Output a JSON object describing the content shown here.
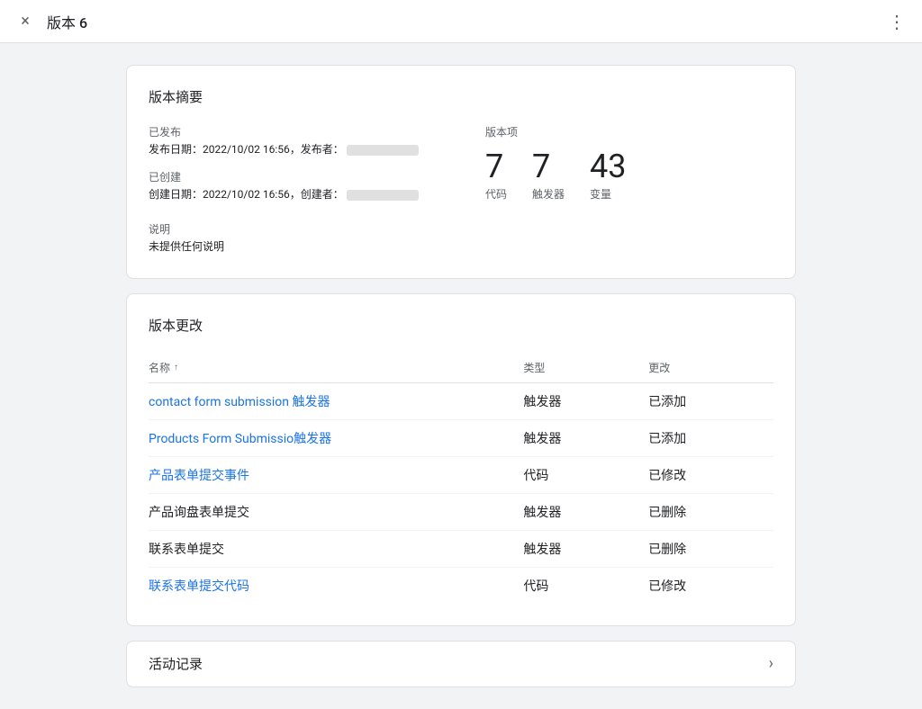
{
  "topBar": {
    "title": "版本 6",
    "closeLabel": "×",
    "moreLabel": "⋮"
  },
  "summaryCard": {
    "title": "版本摘要",
    "publishedLabel": "已发布",
    "publishedDate": "发布日期：2022/10/02 16:56，发布者：",
    "createdLabel": "已创建",
    "createdDate": "创建日期：2022/10/02 16:56，创建者：",
    "descriptionLabel": "说明",
    "descriptionValue": "未提供任何说明",
    "versionItemsLabel": "版本项",
    "stats": [
      {
        "number": "7",
        "label": "代码"
      },
      {
        "number": "7",
        "label": "触发器"
      },
      {
        "number": "43",
        "label": "变量"
      }
    ]
  },
  "changesCard": {
    "title": "版本更改",
    "columns": {
      "name": "名称",
      "type": "类型",
      "change": "更改"
    },
    "rows": [
      {
        "name": "contact form submission 触发器",
        "type": "触发器",
        "change": "已添加",
        "isLink": true
      },
      {
        "name": "Products Form Submissio触发器",
        "type": "触发器",
        "change": "已添加",
        "isLink": true
      },
      {
        "name": "产品表单提交事件",
        "type": "代码",
        "change": "已修改",
        "isLink": true
      },
      {
        "name": "产品询盘表单提交",
        "type": "触发器",
        "change": "已删除",
        "isLink": false
      },
      {
        "name": "联系表单提交",
        "type": "触发器",
        "change": "已删除",
        "isLink": false
      },
      {
        "name": "联系表单提交代码",
        "type": "代码",
        "change": "已修改",
        "isLink": true
      }
    ]
  },
  "activityCard": {
    "title": "活动记录",
    "chevron": "›"
  }
}
